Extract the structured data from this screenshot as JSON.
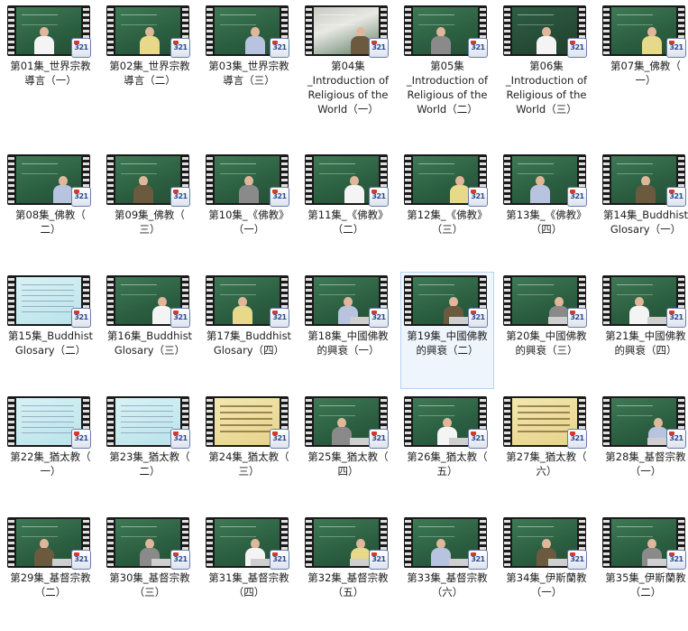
{
  "badge_text": "321",
  "colors": {
    "selection_bg": "#eef5fd",
    "selection_border": "#b6d4f2",
    "label_text": "#1e1e1e"
  },
  "selected_index": 18,
  "items": [
    {
      "line1": "第01集_世界宗教",
      "line2": "導言（一）",
      "line3": "",
      "thumb": "chalk"
    },
    {
      "line1": "第02集_世界宗教",
      "line2": "導言（二）",
      "line3": "",
      "thumb": "chalk"
    },
    {
      "line1": "第03集_世界宗教",
      "line2": "導言（三）",
      "line3": "",
      "thumb": "chalk"
    },
    {
      "line1": "第04集",
      "line2": "_Introduction of",
      "line3": "Religious of the",
      "line4": "World（一）",
      "thumb": "room"
    },
    {
      "line1": "第05集",
      "line2": "_Introduction of",
      "line3": "Religious of the",
      "line4": "World（二）",
      "thumb": "chalk"
    },
    {
      "line1": "第06集",
      "line2": "_Introduction of",
      "line3": "Religious of the",
      "line4": "World（三）",
      "thumb": "dark"
    },
    {
      "line1": "第07集_佛教（",
      "line2": "一）",
      "line3": "",
      "thumb": "chalk"
    },
    {
      "line1": "第08集_佛教（",
      "line2": "二）",
      "line3": "",
      "thumb": "chalk"
    },
    {
      "line1": "第09集_佛教（",
      "line2": "三）",
      "line3": "",
      "thumb": "chalk"
    },
    {
      "line1": "第10集_《佛教》",
      "line2": "（一）",
      "line3": "",
      "thumb": "chalk"
    },
    {
      "line1": "第11集_《佛教》",
      "line2": "（二）",
      "line3": "",
      "thumb": "chalk"
    },
    {
      "line1": "第12集_《佛教》",
      "line2": "（三）",
      "line3": "",
      "thumb": "chalk"
    },
    {
      "line1": "第13集_《佛教》",
      "line2": "（四）",
      "line3": "",
      "thumb": "chalk"
    },
    {
      "line1": "第14集_Buddhist",
      "line2": "Glosary（一）",
      "line3": "",
      "thumb": "chalk"
    },
    {
      "line1": "第15集_Buddhist",
      "line2": "Glosary（二）",
      "line3": "",
      "thumb": "light"
    },
    {
      "line1": "第16集_Buddhist",
      "line2": "Glosary（三）",
      "line3": "",
      "thumb": "chalk"
    },
    {
      "line1": "第17集_Buddhist",
      "line2": "Glosary（四）",
      "line3": "",
      "thumb": "chalk"
    },
    {
      "line1": "第18集_中國佛教",
      "line2": "的興衰（一）",
      "line3": "",
      "thumb": "chalk"
    },
    {
      "line1": "第19集_中國佛教",
      "line2": "的興衰（二）",
      "line3": "",
      "thumb": "chalk"
    },
    {
      "line1": "第20集_中國佛教",
      "line2": "的興衰（三）",
      "line3": "",
      "thumb": "chalk"
    },
    {
      "line1": "第21集_中國佛教",
      "line2": "的興衰（四）",
      "line3": "",
      "thumb": "chalk"
    },
    {
      "line1": "第22集_猶太教（",
      "line2": "一）",
      "line3": "",
      "thumb": "light"
    },
    {
      "line1": "第23集_猶太教（",
      "line2": "二）",
      "line3": "",
      "thumb": "light"
    },
    {
      "line1": "第24集_猶太教（",
      "line2": "三）",
      "line3": "",
      "thumb": "yellow"
    },
    {
      "line1": "第25集_猶太教（",
      "line2": "四）",
      "line3": "",
      "thumb": "chalk"
    },
    {
      "line1": "第26集_猶太教（",
      "line2": "五）",
      "line3": "",
      "thumb": "chalk"
    },
    {
      "line1": "第27集_猶太教（",
      "line2": "六）",
      "line3": "",
      "thumb": "yellow"
    },
    {
      "line1": "第28集_基督宗教",
      "line2": "（一）",
      "line3": "",
      "thumb": "chalk"
    },
    {
      "line1": "第29集_基督宗教",
      "line2": "（二）",
      "line3": "",
      "thumb": "chalk"
    },
    {
      "line1": "第30集_基督宗教",
      "line2": "（三）",
      "line3": "",
      "thumb": "chalk"
    },
    {
      "line1": "第31集_基督宗教",
      "line2": "（四）",
      "line3": "",
      "thumb": "chalk"
    },
    {
      "line1": "第32集_基督宗教",
      "line2": "（五）",
      "line3": "",
      "thumb": "chalk"
    },
    {
      "line1": "第33集_基督宗教",
      "line2": "（六）",
      "line3": "",
      "thumb": "chalk"
    },
    {
      "line1": "第34集_伊斯蘭教",
      "line2": "（一）",
      "line3": "",
      "thumb": "chalk"
    },
    {
      "line1": "第35集_伊斯蘭教",
      "line2": "（二）",
      "line3": "",
      "thumb": "chalk"
    }
  ]
}
